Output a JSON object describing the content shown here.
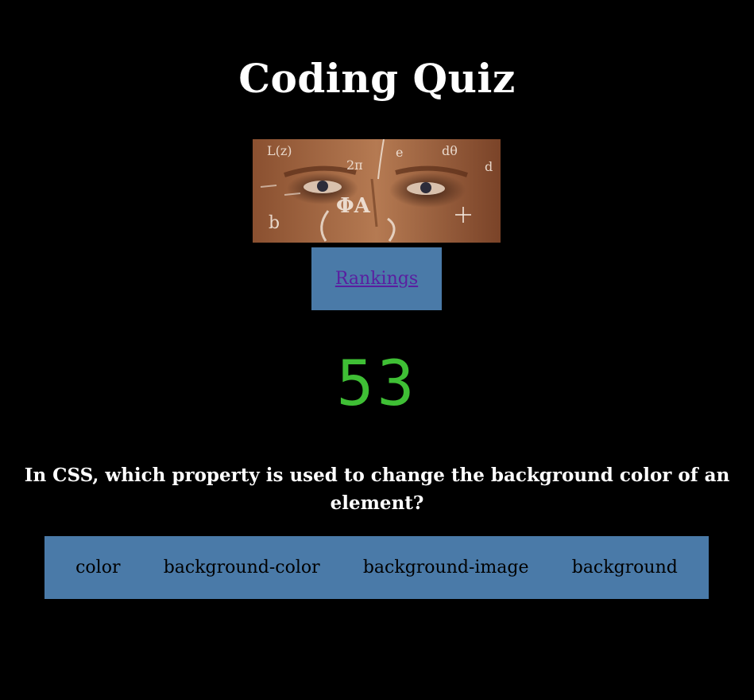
{
  "header": {
    "title": "Coding Quiz"
  },
  "hero_image": {
    "alt": "face with math formulas",
    "formula_marks": [
      "∫",
      "L(z)",
      "2π",
      "ΦA",
      "e",
      "dθ",
      "b",
      "d"
    ]
  },
  "nav": {
    "rankings_label": "Rankings"
  },
  "timer": {
    "value": "53",
    "color": "#3fbf35"
  },
  "quiz": {
    "question": "In CSS, which property is used to change the background color of an element?",
    "answers": [
      "color",
      "background-color",
      "background-image",
      "background"
    ]
  },
  "colors": {
    "background": "#000000",
    "panel": "#4a7aa8",
    "link": "#5a1ea0"
  }
}
